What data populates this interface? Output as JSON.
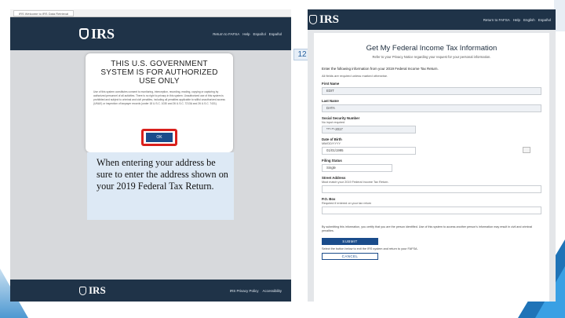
{
  "left_window": {
    "tab_title": "IRS Welcome to IRS Data Retrieval",
    "logo_text": "IRS",
    "nav": [
      "Return to FAFSA",
      "Help",
      "Español",
      "Español"
    ],
    "notice": {
      "title": "THIS U.S. GOVERNMENT SYSTEM IS FOR AUTHORIZED USE ONLY",
      "body": "Use of this system constitutes consent to monitoring, interception, recording, reading, copying or capturing by authorized personnel of all activities. There is no right to privacy in this system. Unauthorized use of this system is prohibited and subject to criminal and civil penalties, including all penalties applicable to willful unauthorized access (UNAX) or inspection of taxpayer records (under 18 U.S.C. 1030 and 26 U.S.C. 7213A and 26 U.S.C. 7431).",
      "ok_label": "OK"
    },
    "caption": "When entering your address be sure to enter the address shown on your 2019 Federal Tax Return.",
    "footer_logo": "IRS",
    "footer_links": [
      "IRS Privacy Policy",
      "Accessibility"
    ]
  },
  "slide_number": "12",
  "right_window": {
    "logo_text": "IRS",
    "nav": [
      "Return to FAFSA",
      "Help",
      "English",
      "Español"
    ],
    "form": {
      "title": "Get My Federal Income Tax Information",
      "subtitle": "Refer to your Privacy Notice regarding your request for your personal information.",
      "instruction": "Enter the following information from your 2019 Federal Income Tax Return.",
      "required_note": "All fields are required unless marked otherwise.",
      "fields": [
        {
          "label": "First Name",
          "hint": "",
          "value": "EDIT"
        },
        {
          "label": "Last Name",
          "hint": "",
          "value": "DATA"
        },
        {
          "label": "Social Security Number",
          "hint": "No input required",
          "value": "***-**-2017"
        },
        {
          "label": "Date of Birth",
          "hint": "MM/DD/YYYY",
          "value": "01/01/1995"
        },
        {
          "label": "Filing Status",
          "hint": "",
          "value": "Single"
        },
        {
          "label": "Street Address",
          "hint": "Must match your 2019 Federal Income Tax Return.",
          "value": ""
        },
        {
          "label": "P.O. Box",
          "hint": "Required if entered on your tax return",
          "value": ""
        }
      ],
      "consent": "By submitting this information, you certify that you are the person identified. Use of this system to access another person's information may result in civil and criminal penalties.",
      "submit_label": "SUBMIT",
      "return_note": "Select the button below to exit the IRS system and return to your FAFSA.",
      "cancel_label": "CANCEL"
    }
  }
}
